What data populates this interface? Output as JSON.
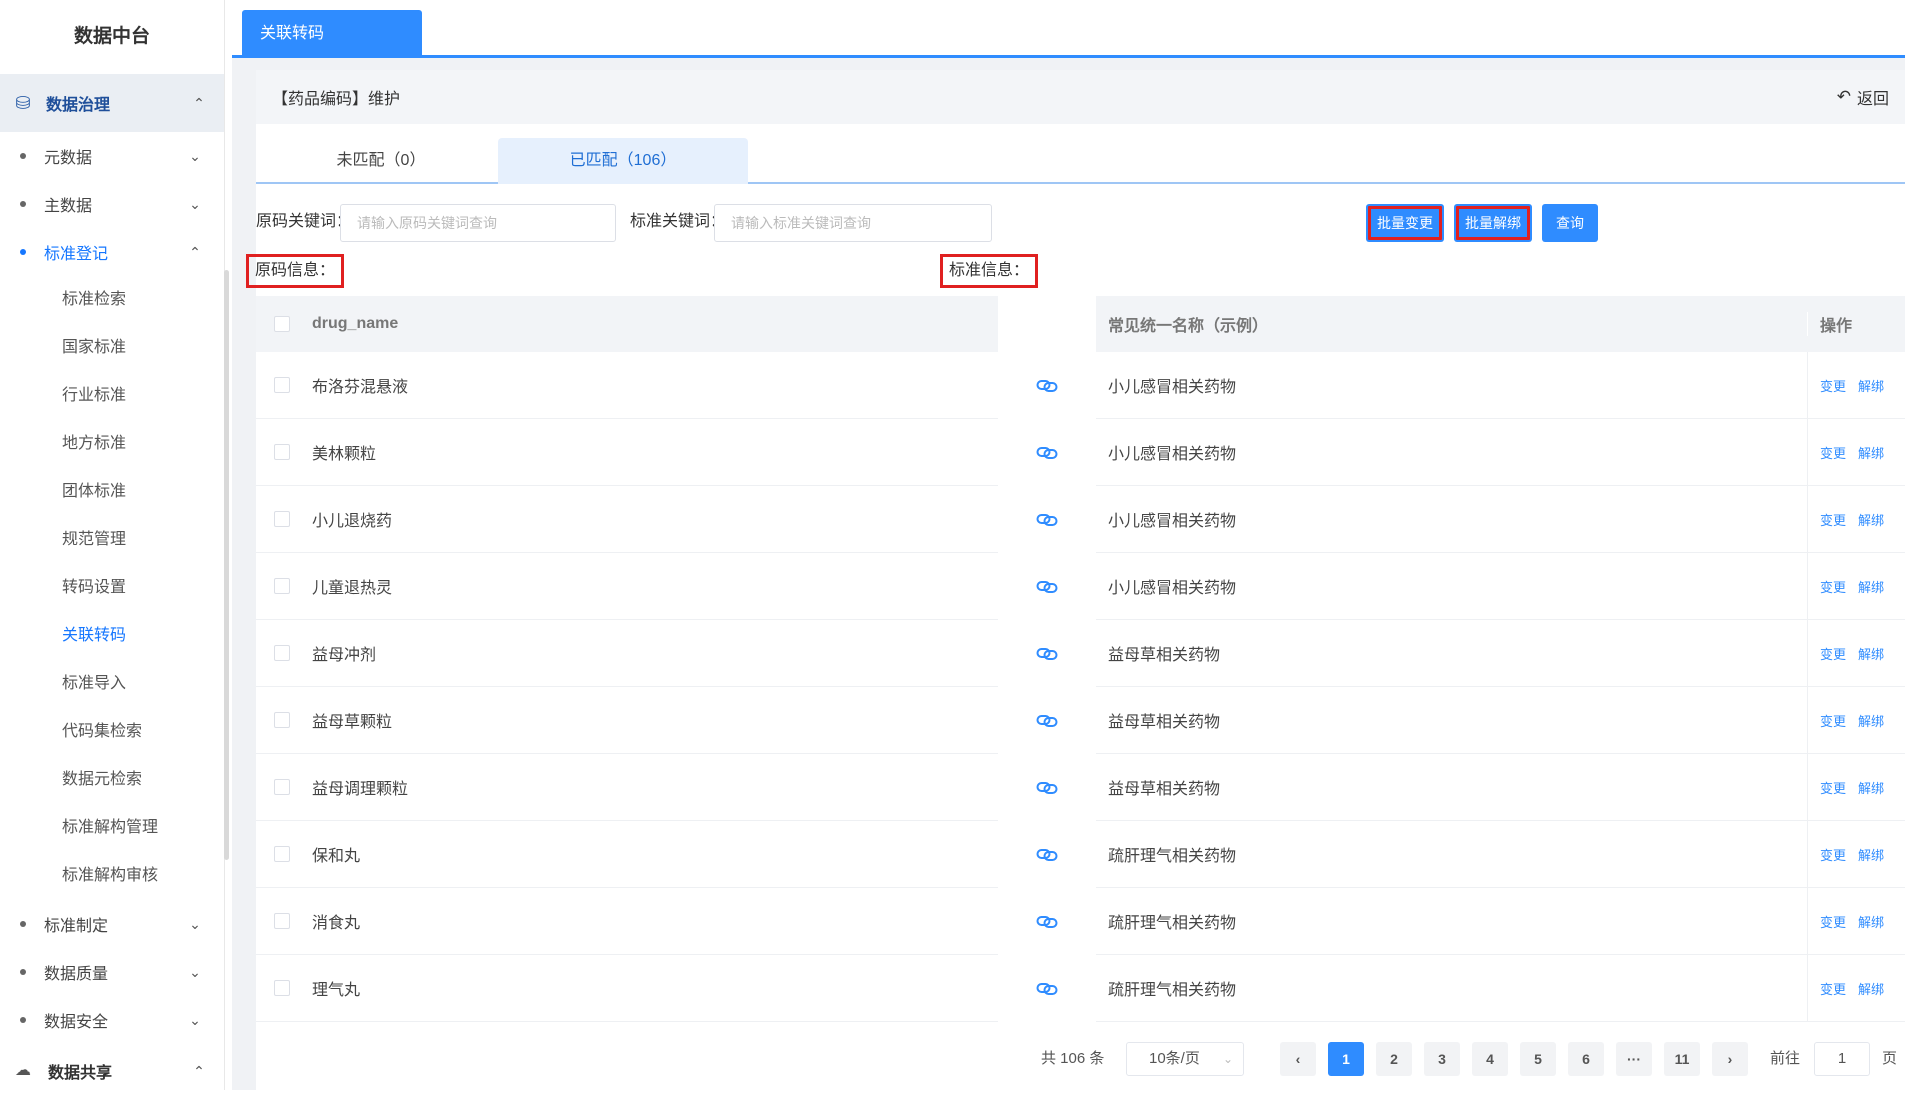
{
  "sidebar": {
    "brand": "数据中台",
    "top_menu": "数据治理",
    "groups": [
      {
        "label": "元数据"
      },
      {
        "label": "主数据"
      }
    ],
    "active_group": "标准登记",
    "leaves": [
      "标准检索",
      "国家标准",
      "行业标准",
      "地方标准",
      "团体标准",
      "规范管理",
      "转码设置",
      "关联转码",
      "标准导入",
      "代码集检索",
      "数据元检索",
      "标准解构管理",
      "标准解构审核"
    ],
    "after_groups": [
      {
        "label": "标准制定"
      },
      {
        "label": "数据质量"
      },
      {
        "label": "数据安全"
      }
    ],
    "bottom_menu": "数据共享"
  },
  "tabbar": {
    "active_tab": "关联转码"
  },
  "panel": {
    "title": "【药品编码】维护",
    "back_label": "返回"
  },
  "subtabs": [
    "未匹配（0）",
    "已匹配（106）"
  ],
  "search": {
    "source_label": "原码关键词：",
    "source_placeholder": "请输入原码关键词查询",
    "standard_label": "标准关键词：",
    "standard_placeholder": "请输入标准关键词查询",
    "batch_change": "批量变更",
    "batch_unbind": "批量解绑",
    "query": "查询"
  },
  "sections": {
    "source": "原码信息：",
    "standard": "标准信息："
  },
  "left_table": {
    "header": "drug_name",
    "rows": [
      "布洛芬混悬液",
      "美林颗粒",
      "小儿退烧药",
      "儿童退热灵",
      "益母冲剂",
      "益母草颗粒",
      "益母调理颗粒",
      "保和丸",
      "消食丸",
      "理气丸"
    ]
  },
  "right_table": {
    "header_name": "常见统一名称（示例）",
    "header_op": "操作",
    "op_change": "变更",
    "op_unbind": "解绑",
    "rows": [
      "小儿感冒相关药物",
      "小儿感冒相关药物",
      "小儿感冒相关药物",
      "小儿感冒相关药物",
      "益母草相关药物",
      "益母草相关药物",
      "益母草相关药物",
      "疏肝理气相关药物",
      "疏肝理气相关药物",
      "疏肝理气相关药物"
    ]
  },
  "pagination": {
    "total": "共 106 条",
    "page_size": "10条/页",
    "prev": "‹",
    "pages": [
      "1",
      "2",
      "3",
      "4",
      "5",
      "6",
      "···",
      "11"
    ],
    "next": "›",
    "goto_label": "前往",
    "goto_value": "1",
    "goto_unit": "页"
  },
  "colors": {
    "accent": "#2f8cff",
    "highlight_box": "#e02020"
  }
}
